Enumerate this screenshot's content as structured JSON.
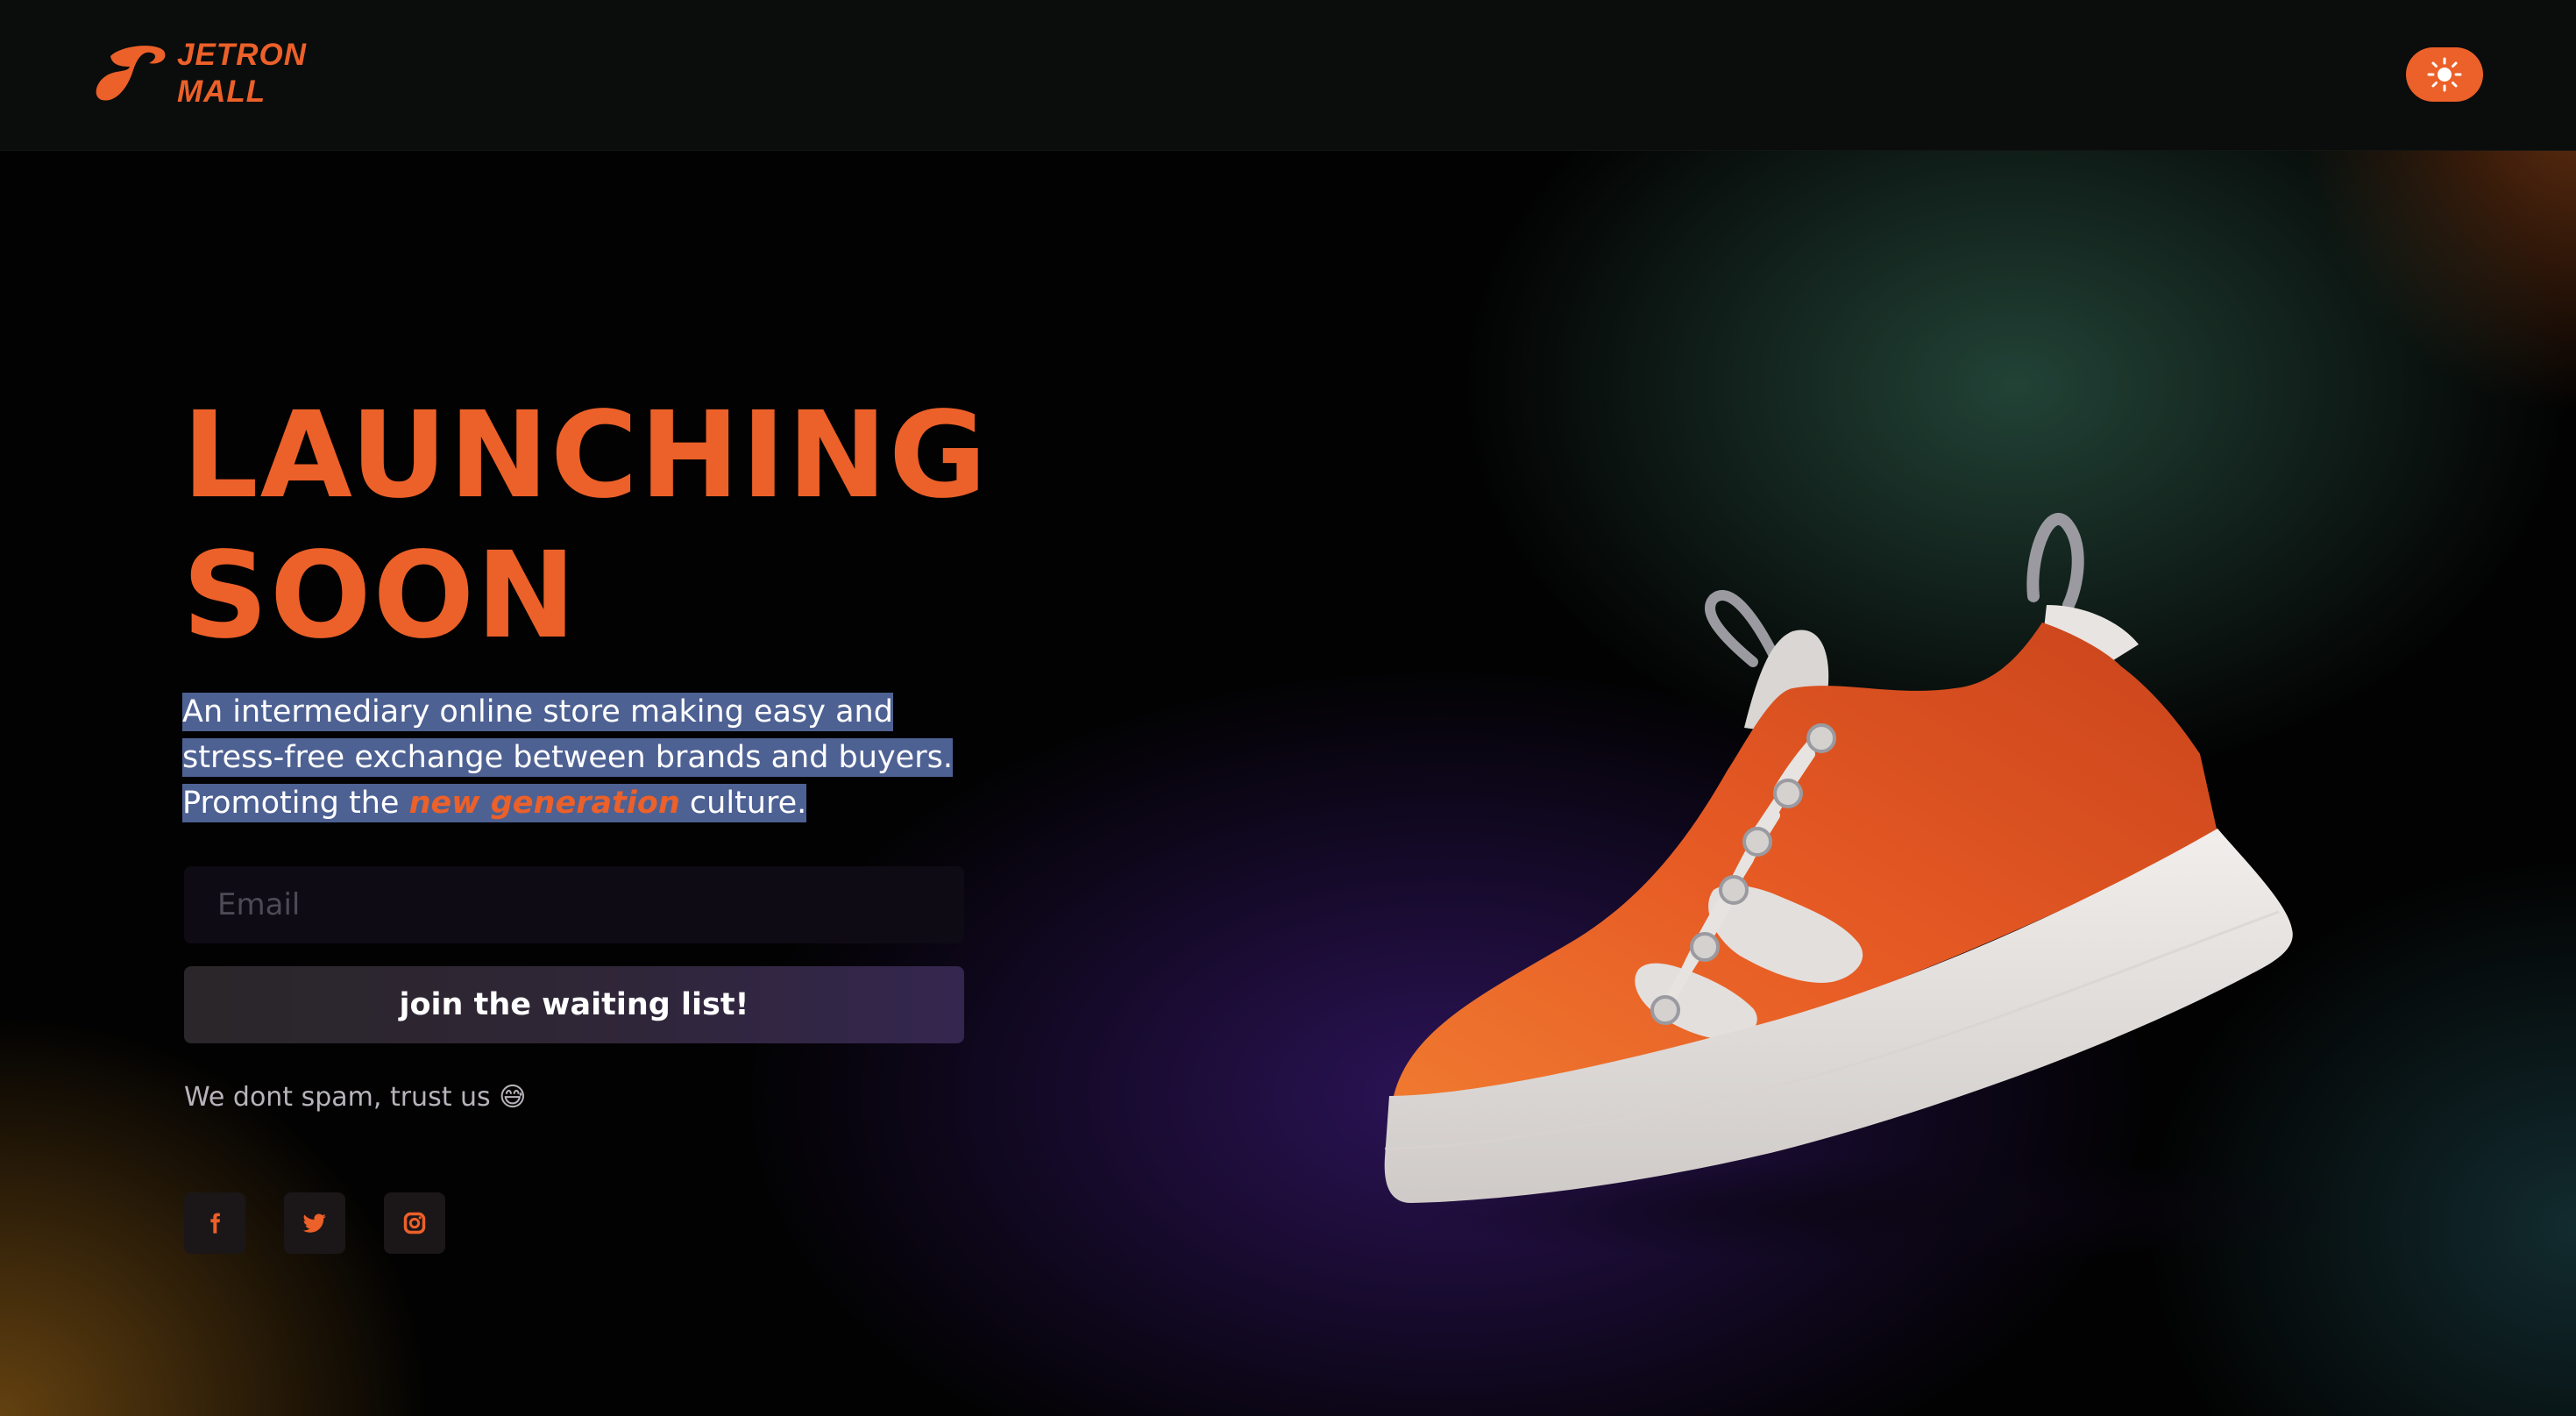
{
  "header": {
    "brand_line1": "JETRON",
    "brand_line2": "MALL",
    "theme_toggle_icon": "sun-icon"
  },
  "hero": {
    "title_line1": "LAUNCHING",
    "title_line2": "SOON",
    "tagline_line1": "An intermediary online store making easy and",
    "tagline_line2": "stress-free exchange between brands and buyers.",
    "tagline_line3_prefix": "Promoting the ",
    "tagline_highlight": "new generation",
    "tagline_line3_suffix": " culture."
  },
  "signup": {
    "email_placeholder": "Email",
    "email_value": "",
    "button_label": "join the waiting list!",
    "note": "We dont spam, trust us 😅"
  },
  "social": [
    {
      "icon": "facebook-icon"
    },
    {
      "icon": "twitter-icon"
    },
    {
      "icon": "instagram-icon"
    }
  ],
  "colors": {
    "accent": "#ec6029",
    "header_bg": "#0b0c0c",
    "selection": "#4e6193"
  }
}
